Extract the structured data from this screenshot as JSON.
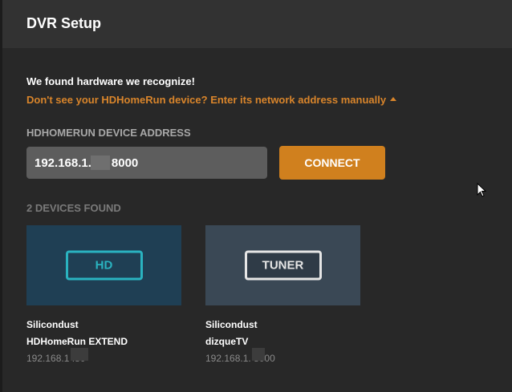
{
  "dialog": {
    "title": "DVR Setup"
  },
  "main": {
    "found_text": "We found hardware we recognize!",
    "manual_link": "Don't see your HDHomeRun device? Enter its network address manually",
    "address_label": "HDHOMERUN DEVICE ADDRESS",
    "address_value": "192.168.1.      8000",
    "connect_label": "CONNECT",
    "devices_label": "2 DEVICES FOUND"
  },
  "devices": [
    {
      "badge": "HD",
      "make": "Silicondust",
      "model": "HDHomeRun EXTEND",
      "ip": "192.168.1      :80"
    },
    {
      "badge": "TUNER",
      "make": "Silicondust",
      "model": "dizqueTV",
      "ip": "192.168.1.      8000"
    }
  ],
  "colors": {
    "accent": "#d0801e",
    "link": "#d9852b",
    "hd_badge": "#2ab3c0",
    "hd_card": "#1f3f54",
    "tuner_card": "#3a4855"
  },
  "icons": {
    "manual_toggle": "caret-up-icon",
    "pointer": "mouse-cursor-icon"
  }
}
